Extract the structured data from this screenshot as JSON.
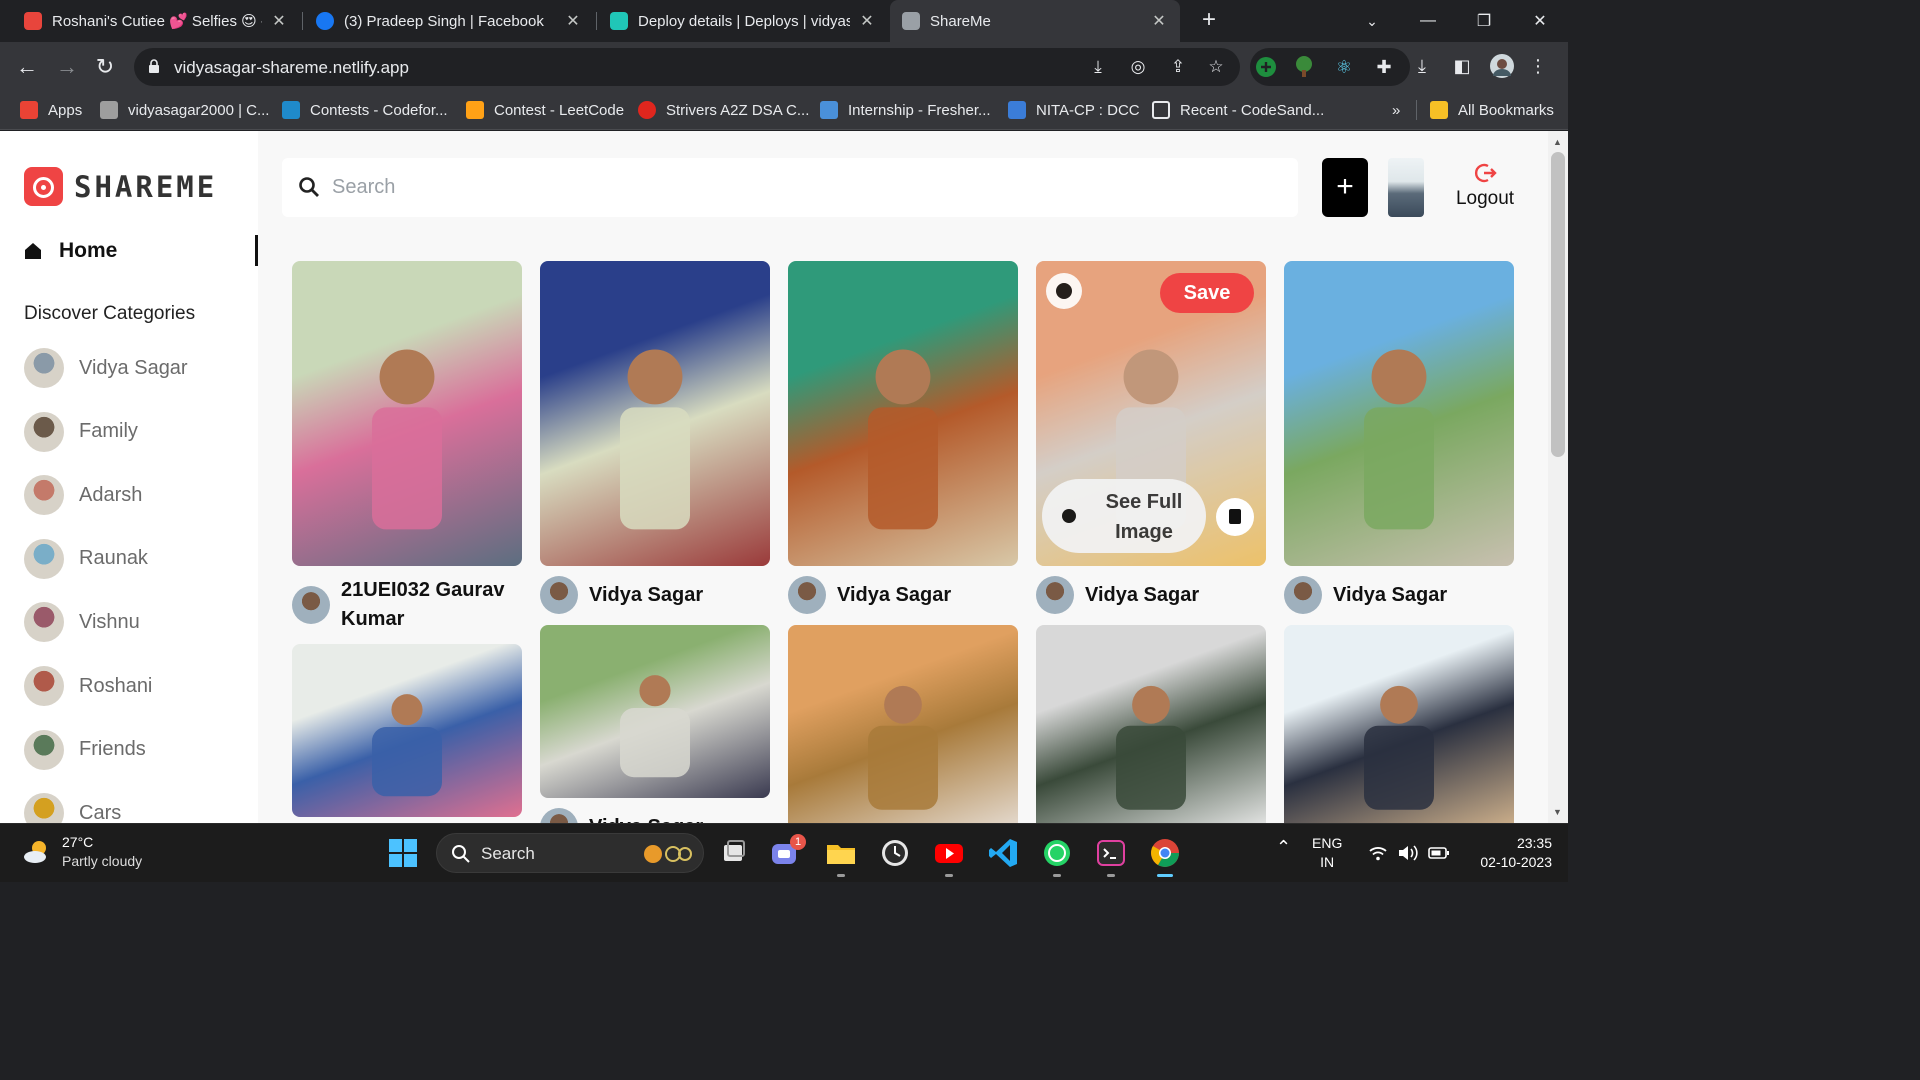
{
  "browser": {
    "tabs": [
      {
        "title": "Roshani's Cutiee 💕 Selfies 😍 -",
        "favicon_color": "#e8453c",
        "active": false
      },
      {
        "title": "(3) Pradeep Singh | Facebook",
        "favicon_color": "#1877f2",
        "active": false
      },
      {
        "title": "Deploy details | Deploys | vidyas",
        "favicon_color": "#20c6b7",
        "active": false
      },
      {
        "title": "ShareMe",
        "favicon_color": "#9aa0a6",
        "active": true
      }
    ],
    "url": "vidyasagar-shareme.netlify.app",
    "bookmarks": [
      {
        "label": "Apps",
        "color": "#ea4335"
      },
      {
        "label": "vidyasagar2000 | C...",
        "color": "#9e9e9e"
      },
      {
        "label": "Contests - Codefor...",
        "color": "#1f8acb"
      },
      {
        "label": "Contest - LeetCode",
        "color": "#ffa116"
      },
      {
        "label": "Strivers A2Z DSA C...",
        "color": "#e0261e"
      },
      {
        "label": "Internship - Fresher...",
        "color": "#4a90d9"
      },
      {
        "label": "NITA-CP : DCC",
        "color": "#3b7dd8"
      },
      {
        "label": "Recent - CodeSand...",
        "color": "#e8eaed"
      }
    ],
    "bookmarks_overflow": "»",
    "all_bookmarks": "All Bookmarks"
  },
  "app": {
    "brand": "SHAREME",
    "nav_home": "Home",
    "discover_heading": "Discover Categories",
    "categories": [
      {
        "label": "Vidya Sagar",
        "color": "#8a9aa8"
      },
      {
        "label": "Family",
        "color": "#6b5a4a"
      },
      {
        "label": "Adarsh",
        "color": "#c47a6a"
      },
      {
        "label": "Raunak",
        "color": "#7aaec8"
      },
      {
        "label": "Vishnu",
        "color": "#9a5a6a"
      },
      {
        "label": "Roshani",
        "color": "#b05a4a"
      },
      {
        "label": "Friends",
        "color": "#5a7a5a"
      },
      {
        "label": "Cars",
        "color": "#d4a020"
      }
    ],
    "search_placeholder": "Search",
    "add_label": "+",
    "logout_label": "Logout",
    "accent_color": "#ef4444"
  },
  "pins": [
    {
      "author": "21UEI032 Gaurav Kumar",
      "palette": [
        "#c9d8b8",
        "#d96f9a",
        "#5c6e80"
      ]
    },
    {
      "author": "Vidya Sagar",
      "palette": [
        "#2a3f8a",
        "#d8dcc0",
        "#9a3a3a"
      ]
    },
    {
      "author": "Vidya Sagar",
      "palette": [
        "#2f9a7a",
        "#b45a2a",
        "#d8c8a8"
      ]
    },
    {
      "author": "Vidya Sagar",
      "palette": [
        "#e08a5a",
        "#c8c0b8",
        "#e8b040"
      ],
      "hover": {
        "save": "Save",
        "see_full": "See Full Image"
      }
    },
    {
      "author": "Vidya Sagar",
      "palette": [
        "#6ab0e0",
        "#7aa860",
        "#c8c0b0"
      ]
    },
    {
      "author": "",
      "palette": [
        "#e8ece8",
        "#3a60a8",
        "#e07090"
      ]
    },
    {
      "author": "Vidya Sagar",
      "palette": [
        "#8ab070",
        "#d8d8d0",
        "#3a3a50"
      ]
    },
    {
      "author": "",
      "palette": [
        "#e0a060",
        "#a87a3a",
        "#e8e0d8"
      ]
    },
    {
      "author": "",
      "palette": [
        "#d8d8d8",
        "#3a4a3a",
        "#f0f0f0"
      ]
    },
    {
      "author": "",
      "palette": [
        "#e8f0f4",
        "#2a3040",
        "#d8b890"
      ]
    }
  ],
  "taskbar": {
    "weather_temp": "27°C",
    "weather_desc": "Partly cloudy",
    "search_label": "Search",
    "lang_line1": "ENG",
    "lang_line2": "IN",
    "time": "23:35",
    "date": "02-10-2023",
    "chat_badge": "1"
  }
}
